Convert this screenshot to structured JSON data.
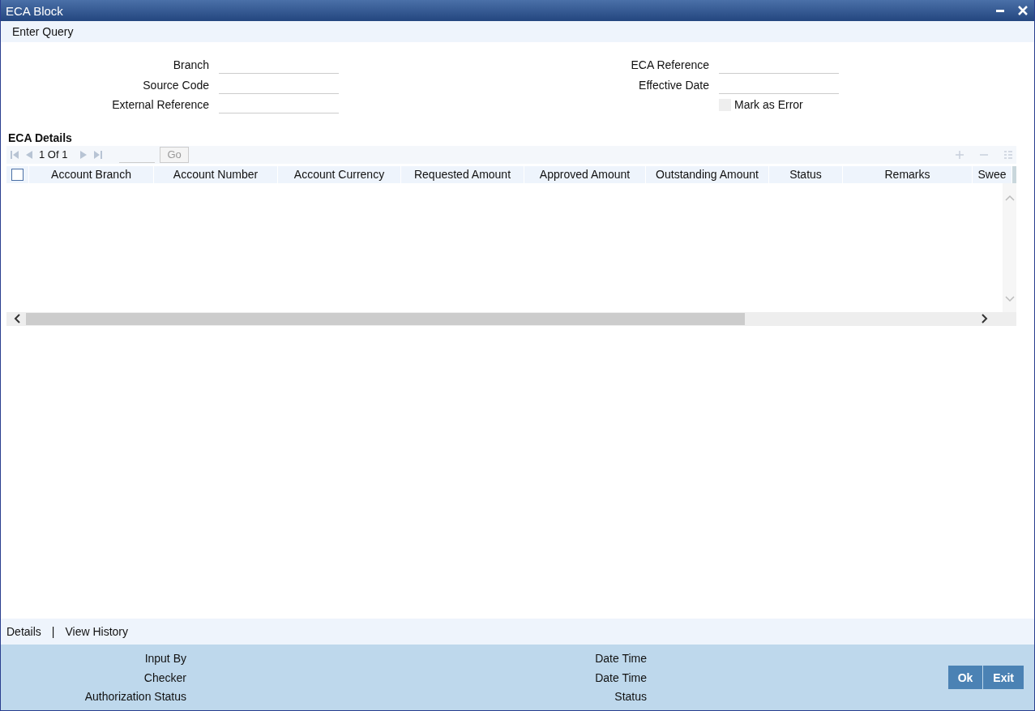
{
  "window": {
    "title": "ECA Block"
  },
  "toolbar": [
    "Enter Query"
  ],
  "form": {
    "left": [
      {
        "label": "Branch"
      },
      {
        "label": "Source Code"
      },
      {
        "label": "External Reference"
      }
    ],
    "right": [
      {
        "label": "ECA Reference"
      },
      {
        "label": "Effective Date"
      }
    ],
    "mark_as_error": {
      "label": "Mark as Error",
      "checked": false
    }
  },
  "eca_details": {
    "title": "ECA Details",
    "pager": "1 Of 1",
    "go": "Go",
    "select_all_checked": false,
    "columns": [
      "Account Branch",
      "Account Number",
      "Account Currency",
      "Requested Amount",
      "Approved Amount",
      "Outstanding Amount",
      "Status",
      "Remarks",
      "Swee"
    ]
  },
  "footer_links": [
    "Details",
    "|",
    "View History"
  ],
  "audit": {
    "left": [
      "Input By",
      "Checker",
      "Authorization Status"
    ],
    "right": [
      "Date Time",
      "Date Time",
      "Status"
    ]
  },
  "buttons": [
    "Ok",
    "Exit"
  ]
}
